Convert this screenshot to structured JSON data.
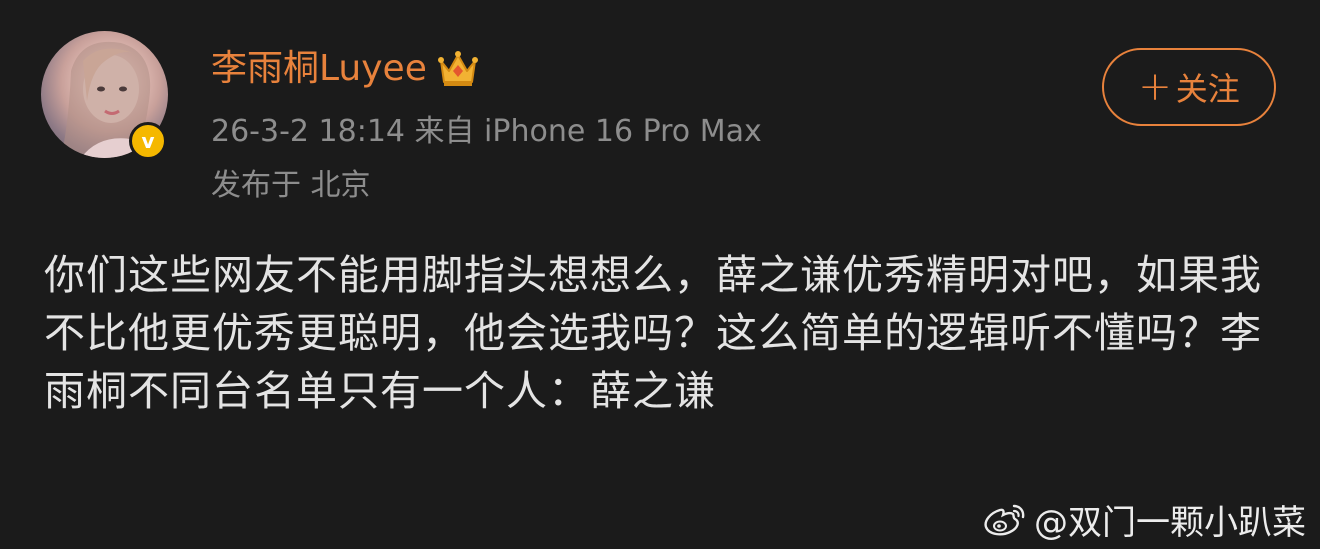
{
  "post": {
    "username": "李雨桐Luyee",
    "meta": "26-3-2 18:14  来自 iPhone 16 Pro Max",
    "location": "发布于 北京",
    "follow_label": "关注",
    "follow_plus": "+",
    "verified_mark": "v",
    "content": "你们这些网友不能用脚指头想想么，薛之谦优秀精明对吧，如果我不比他更优秀更聪明，他会选我吗？这么简单的逻辑听不懂吗？李雨桐不同台名单只有一个人：薛之谦"
  },
  "watermark": {
    "text": "@双门一颗小趴菜"
  },
  "colors": {
    "background": "#1b1b1b",
    "accent": "#e8823c",
    "meta_text": "#8d8d8d",
    "body_text": "#e4e4e4",
    "verified_badge": "#f5b800"
  },
  "icons": {
    "avatar": "profile-photo",
    "badge": "verified-v-icon",
    "crown": "crown-icon",
    "watermark_logo": "weibo-logo-icon"
  }
}
